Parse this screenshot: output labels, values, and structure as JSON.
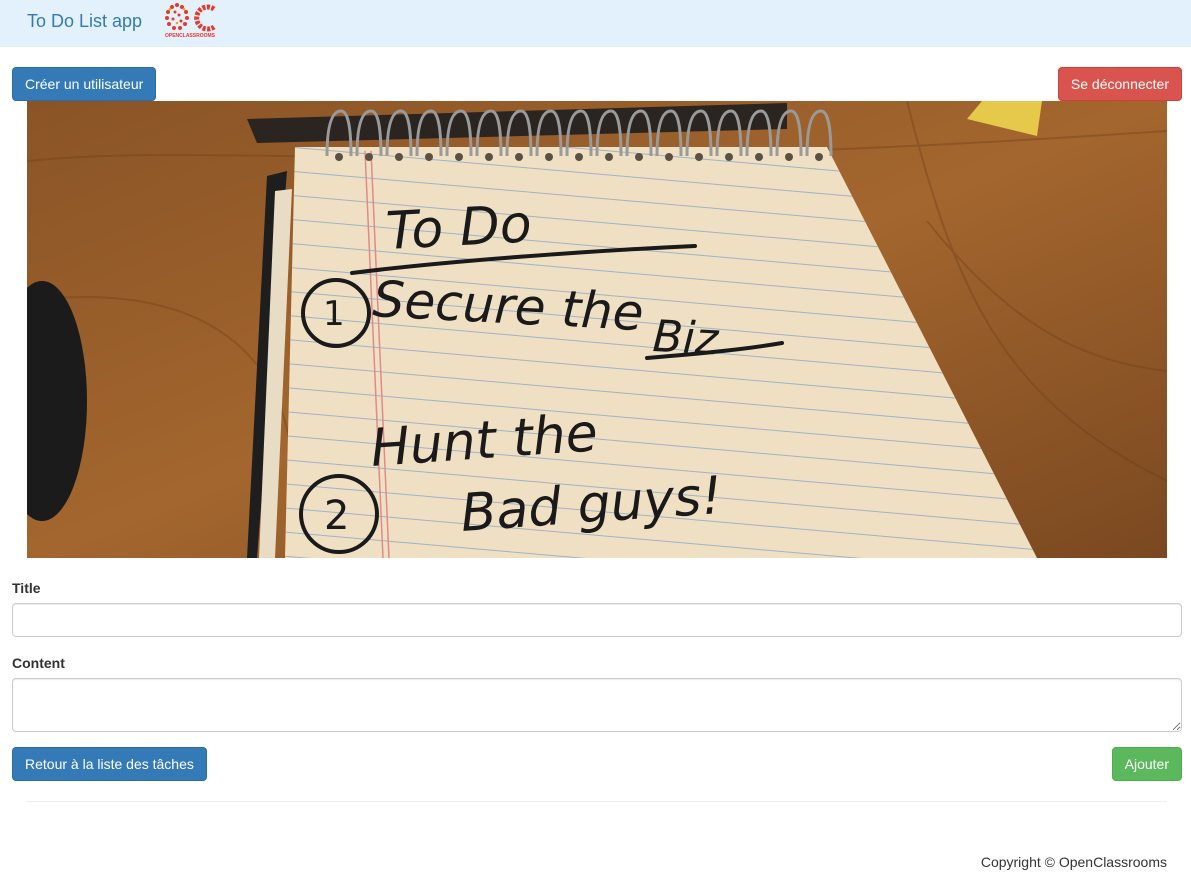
{
  "navbar": {
    "brand": "To Do List app",
    "logo_text": "OPENCLASSROOMS"
  },
  "actions": {
    "create_user": "Créer un utilisateur",
    "logout": "Se déconnecter"
  },
  "hero": {
    "image": "to-do-notebook-photo",
    "heading": "To Do",
    "line1": "Secure the",
    "line1b": "Biz",
    "line2": "Hunt the",
    "line2b": "Bad guys!"
  },
  "form": {
    "title_label": "Title",
    "title_value": "",
    "content_label": "Content",
    "content_value": "",
    "back_label": "Retour à la liste des tâches",
    "submit_label": "Ajouter"
  },
  "footer": {
    "copyright": "Copyright © OpenClassrooms"
  },
  "colors": {
    "navbar_bg": "#e3f1fc",
    "primary": "#337ab7",
    "danger": "#d9534f",
    "success": "#5cb85c"
  }
}
